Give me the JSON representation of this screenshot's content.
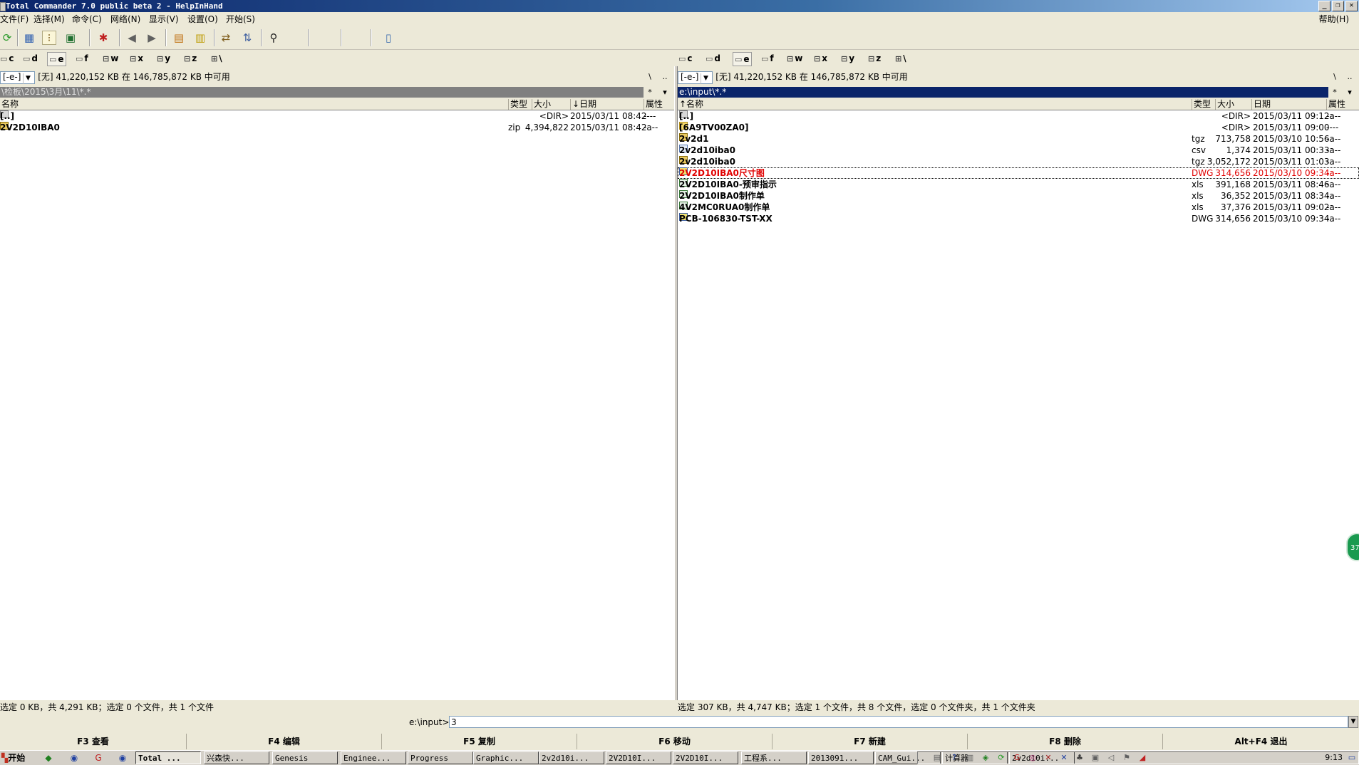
{
  "window": {
    "title": "Total Commander 7.0 public beta 2 - HelpInHand",
    "controls": [
      "_",
      "❐",
      "✕"
    ]
  },
  "menu": {
    "items": [
      "文件(F)",
      "选择(M)",
      "命令(C)",
      "网络(N)",
      "显示(V)",
      "设置(O)",
      "开始(S)"
    ],
    "help": "帮助(H)"
  },
  "toolbar": {
    "icons": [
      "refresh-icon",
      "brief-view-icon",
      "tree-view-icon",
      "thumbnail-icon",
      "sparkle-icon",
      "back-icon",
      "forward-icon",
      "pack-icon",
      "unpack-icon",
      "compare-icon",
      "sync-icon",
      "find-icon",
      "notepad-icon"
    ]
  },
  "left": {
    "drives": [
      "c",
      "d",
      "e",
      "f",
      "w",
      "x",
      "y",
      "z",
      "\\"
    ],
    "active_drive": "e",
    "drive_combo": "[-e-]",
    "drive_info": "[无]  41,220,152 KB 在 146,785,872 KB 中可用",
    "path": "\\检板\\2015\\3月\\11\\*.*",
    "root_btn": "\\",
    "up_btn": "..",
    "star_btn": "*",
    "hist_btn": "▾",
    "columns": {
      "name": "名称",
      "ext": "类型",
      "size": "大小",
      "date": "↓日期",
      "attr": "属性"
    },
    "files": [
      {
        "icon": "up",
        "name": "[..]",
        "ext": "",
        "size": "<DIR>",
        "date": "2015/03/11 08:42",
        "attr": "----"
      },
      {
        "icon": "zip",
        "name": "2V2D10IBA0",
        "ext": "zip",
        "size": "4,394,822",
        "date": "2015/03/11 08:42",
        "attr": "-a--"
      }
    ],
    "status": "选定 0 KB，共 4,291 KB；选定 0 个文件，共 1 个文件"
  },
  "right": {
    "drives": [
      "c",
      "d",
      "e",
      "f",
      "w",
      "x",
      "y",
      "z",
      "\\"
    ],
    "active_drive": "e",
    "drive_combo": "[-e-]",
    "drive_info": "[无]  41,220,152 KB 在 146,785,872 KB 中可用",
    "path": "e:\\input\\*.*",
    "root_btn": "\\",
    "up_btn": "..",
    "star_btn": "*",
    "hist_btn": "▾",
    "columns": {
      "name": "↑名称",
      "ext": "类型",
      "size": "大小",
      "date": "日期",
      "attr": "属性"
    },
    "files": [
      {
        "icon": "up",
        "name": "[..]",
        "ext": "",
        "size": "<DIR>",
        "date": "2015/03/11 09:12",
        "attr": "-a--"
      },
      {
        "icon": "folder",
        "name": "[6A9TV00ZA0]",
        "ext": "",
        "size": "<DIR>",
        "date": "2015/03/11 09:00",
        "attr": "----"
      },
      {
        "icon": "zip",
        "name": "2v2d1",
        "ext": "tgz",
        "size": "713,758",
        "date": "2015/03/10 10:56",
        "attr": "-a--"
      },
      {
        "icon": "csv",
        "name": "2v2d10iba0",
        "ext": "csv",
        "size": "1,374",
        "date": "2015/03/11 00:33",
        "attr": "-a--"
      },
      {
        "icon": "zip",
        "name": "2v2d10iba0",
        "ext": "tgz",
        "size": "3,052,172",
        "date": "2015/03/11 01:03",
        "attr": "-a--"
      },
      {
        "icon": "dwg",
        "name": "2V2D10IBA0尺寸图",
        "ext": "DWG",
        "size": "314,656",
        "date": "2015/03/10 09:34",
        "attr": "-a--",
        "selected": true
      },
      {
        "icon": "xls",
        "name": "2V2D10IBA0-预审指示",
        "ext": "xls",
        "size": "391,168",
        "date": "2015/03/11 08:46",
        "attr": "-a--"
      },
      {
        "icon": "xls",
        "name": "2V2D10IBA0制作单",
        "ext": "xls",
        "size": "36,352",
        "date": "2015/03/11 08:34",
        "attr": "-a--"
      },
      {
        "icon": "xls",
        "name": "4V2MC0RUA0制作单",
        "ext": "xls",
        "size": "37,376",
        "date": "2015/03/11 09:02",
        "attr": "-a--"
      },
      {
        "icon": "dwg",
        "name": "PCB-106830-TST-XX",
        "ext": "DWG",
        "size": "314,656",
        "date": "2015/03/10 09:34",
        "attr": "-a--"
      }
    ],
    "status": "选定 307 KB，共 4,747 KB；选定 1 个文件，共 8 个文件，选定 0 个文件夹，共 1 个文件夹"
  },
  "command": {
    "label": "e:\\input>",
    "value": "3"
  },
  "fkeys": [
    "F3 查看",
    "F4 编辑",
    "F5 复制",
    "F6 移动",
    "F7 新建",
    "F8 删除",
    "Alt+F4 退出"
  ],
  "taskbar": {
    "start": "开始",
    "buttons": [
      "Total ...",
      "兴森快...",
      "Genesis",
      "Enginee...",
      "Progress",
      "Graphic...",
      "2v2d10i...",
      "2V2D10I...",
      "2V2D10I...",
      "工程系...",
      "2013091...",
      "CAM_Gui...",
      "计算器",
      "2v2d10i..."
    ],
    "active_button": "Total ...",
    "clock": "9:13"
  },
  "floating_badge": "37"
}
